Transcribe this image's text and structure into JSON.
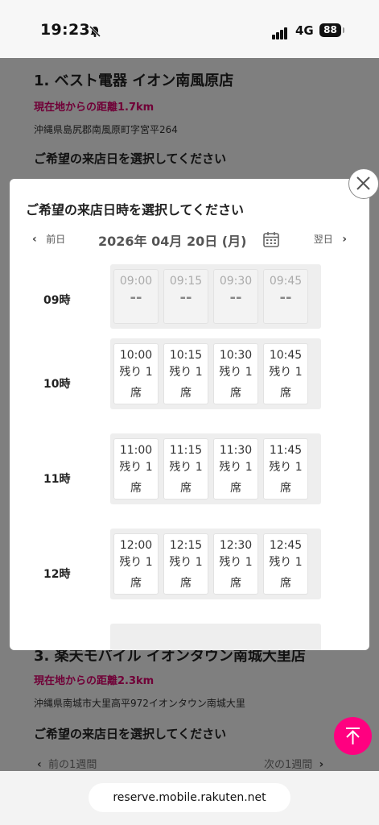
{
  "status": {
    "time": "19:23",
    "network": "4G",
    "battery": "88"
  },
  "background": {
    "store1": {
      "name": "1. ベスト電器 イオン南風原店",
      "distance": "現在地からの距離1.7km",
      "address": "沖縄県島尻郡南風原町字宮平264",
      "prompt": "ご希望の来店日を選択してください"
    },
    "store3": {
      "name": "3. 楽天モバイル イオンタウン南城大里店",
      "distance": "現在地からの距離2.3km",
      "address": "沖縄県南城市大里高平972イオンタウン南城大里",
      "prompt": "ご希望の来店日を選択してください",
      "prev_week": "前の1週間",
      "next_week": "次の1週間"
    }
  },
  "modal": {
    "title": "ご希望の来店日時を選択してください",
    "prev_day": "前日",
    "next_day": "翌日",
    "date": "2026年 04月 20日 (月)",
    "hours": [
      {
        "label": "09時",
        "available": false,
        "slots": [
          {
            "time": "09:00",
            "status": "--"
          },
          {
            "time": "09:15",
            "status": "--"
          },
          {
            "time": "09:30",
            "status": "--"
          },
          {
            "time": "09:45",
            "status": "--"
          }
        ]
      },
      {
        "label": "10時",
        "available": true,
        "slots": [
          {
            "time": "10:00",
            "status1": "残り 1",
            "status2": "席"
          },
          {
            "time": "10:15",
            "status1": "残り 1",
            "status2": "席"
          },
          {
            "time": "10:30",
            "status1": "残り 1",
            "status2": "席"
          },
          {
            "time": "10:45",
            "status1": "残り 1",
            "status2": "席"
          }
        ]
      },
      {
        "label": "11時",
        "available": true,
        "slots": [
          {
            "time": "11:00",
            "status1": "残り 1",
            "status2": "席"
          },
          {
            "time": "11:15",
            "status1": "残り 1",
            "status2": "席"
          },
          {
            "time": "11:30",
            "status1": "残り 1",
            "status2": "席"
          },
          {
            "time": "11:45",
            "status1": "残り 1",
            "status2": "席"
          }
        ]
      },
      {
        "label": "12時",
        "available": true,
        "slots": [
          {
            "time": "12:00",
            "status1": "残り 1",
            "status2": "席"
          },
          {
            "time": "12:15",
            "status1": "残り 1",
            "status2": "席"
          },
          {
            "time": "12:30",
            "status1": "残り 1",
            "status2": "席"
          },
          {
            "time": "12:45",
            "status1": "残り 1",
            "status2": "席"
          }
        ]
      }
    ]
  },
  "url": "reserve.mobile.rakuten.net",
  "colors": {
    "accent": "#e0006e",
    "fab": "#ff0080"
  },
  "icons": {
    "close": "close-icon",
    "calendar": "calendar-icon",
    "scroll_top": "arrow-up-icon"
  }
}
